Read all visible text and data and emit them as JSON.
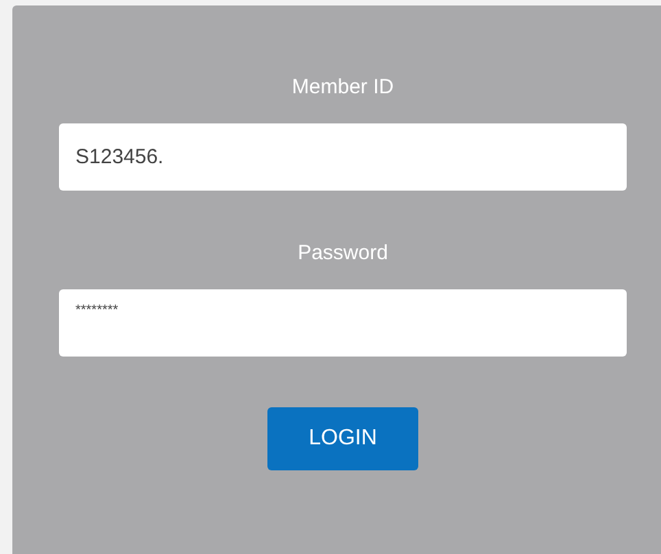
{
  "form": {
    "fields": [
      {
        "label": "Member ID",
        "value": "S123456."
      },
      {
        "label": "Password",
        "value": "********"
      }
    ],
    "button": "LOGIN"
  }
}
